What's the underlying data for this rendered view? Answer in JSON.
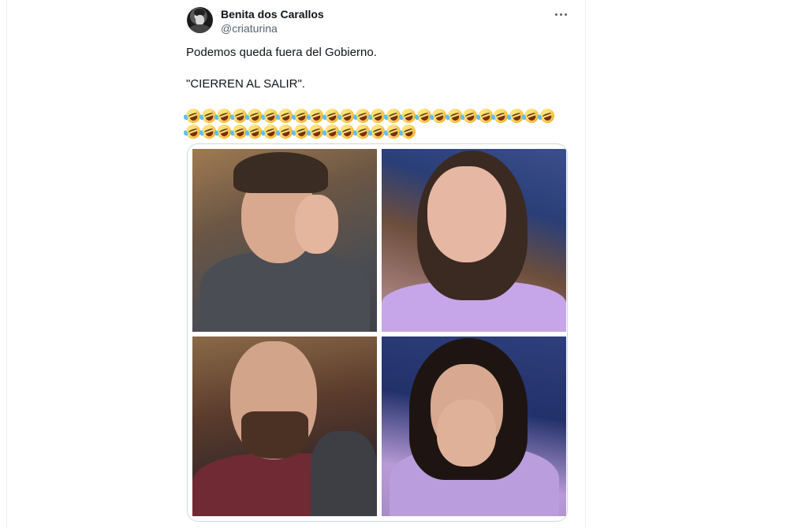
{
  "tweet": {
    "display_name": "Benita dos Carallos",
    "handle": "@criaturina",
    "text_line1": "Podemos queda fuera del Gobierno.",
    "text_line2": "\"CIERREN AL SALIR\".",
    "emoji": {
      "name": "rolling-on-floor-laughing-emoji",
      "row1_count": 24,
      "row2_count": 15
    },
    "media": {
      "photo_count": 4
    }
  },
  "icons": {
    "more": "more-options-icon",
    "avatar": "avatar"
  },
  "colors": {
    "text_primary": "#0f1419",
    "text_secondary": "#536471",
    "border": "#cfd9de"
  }
}
